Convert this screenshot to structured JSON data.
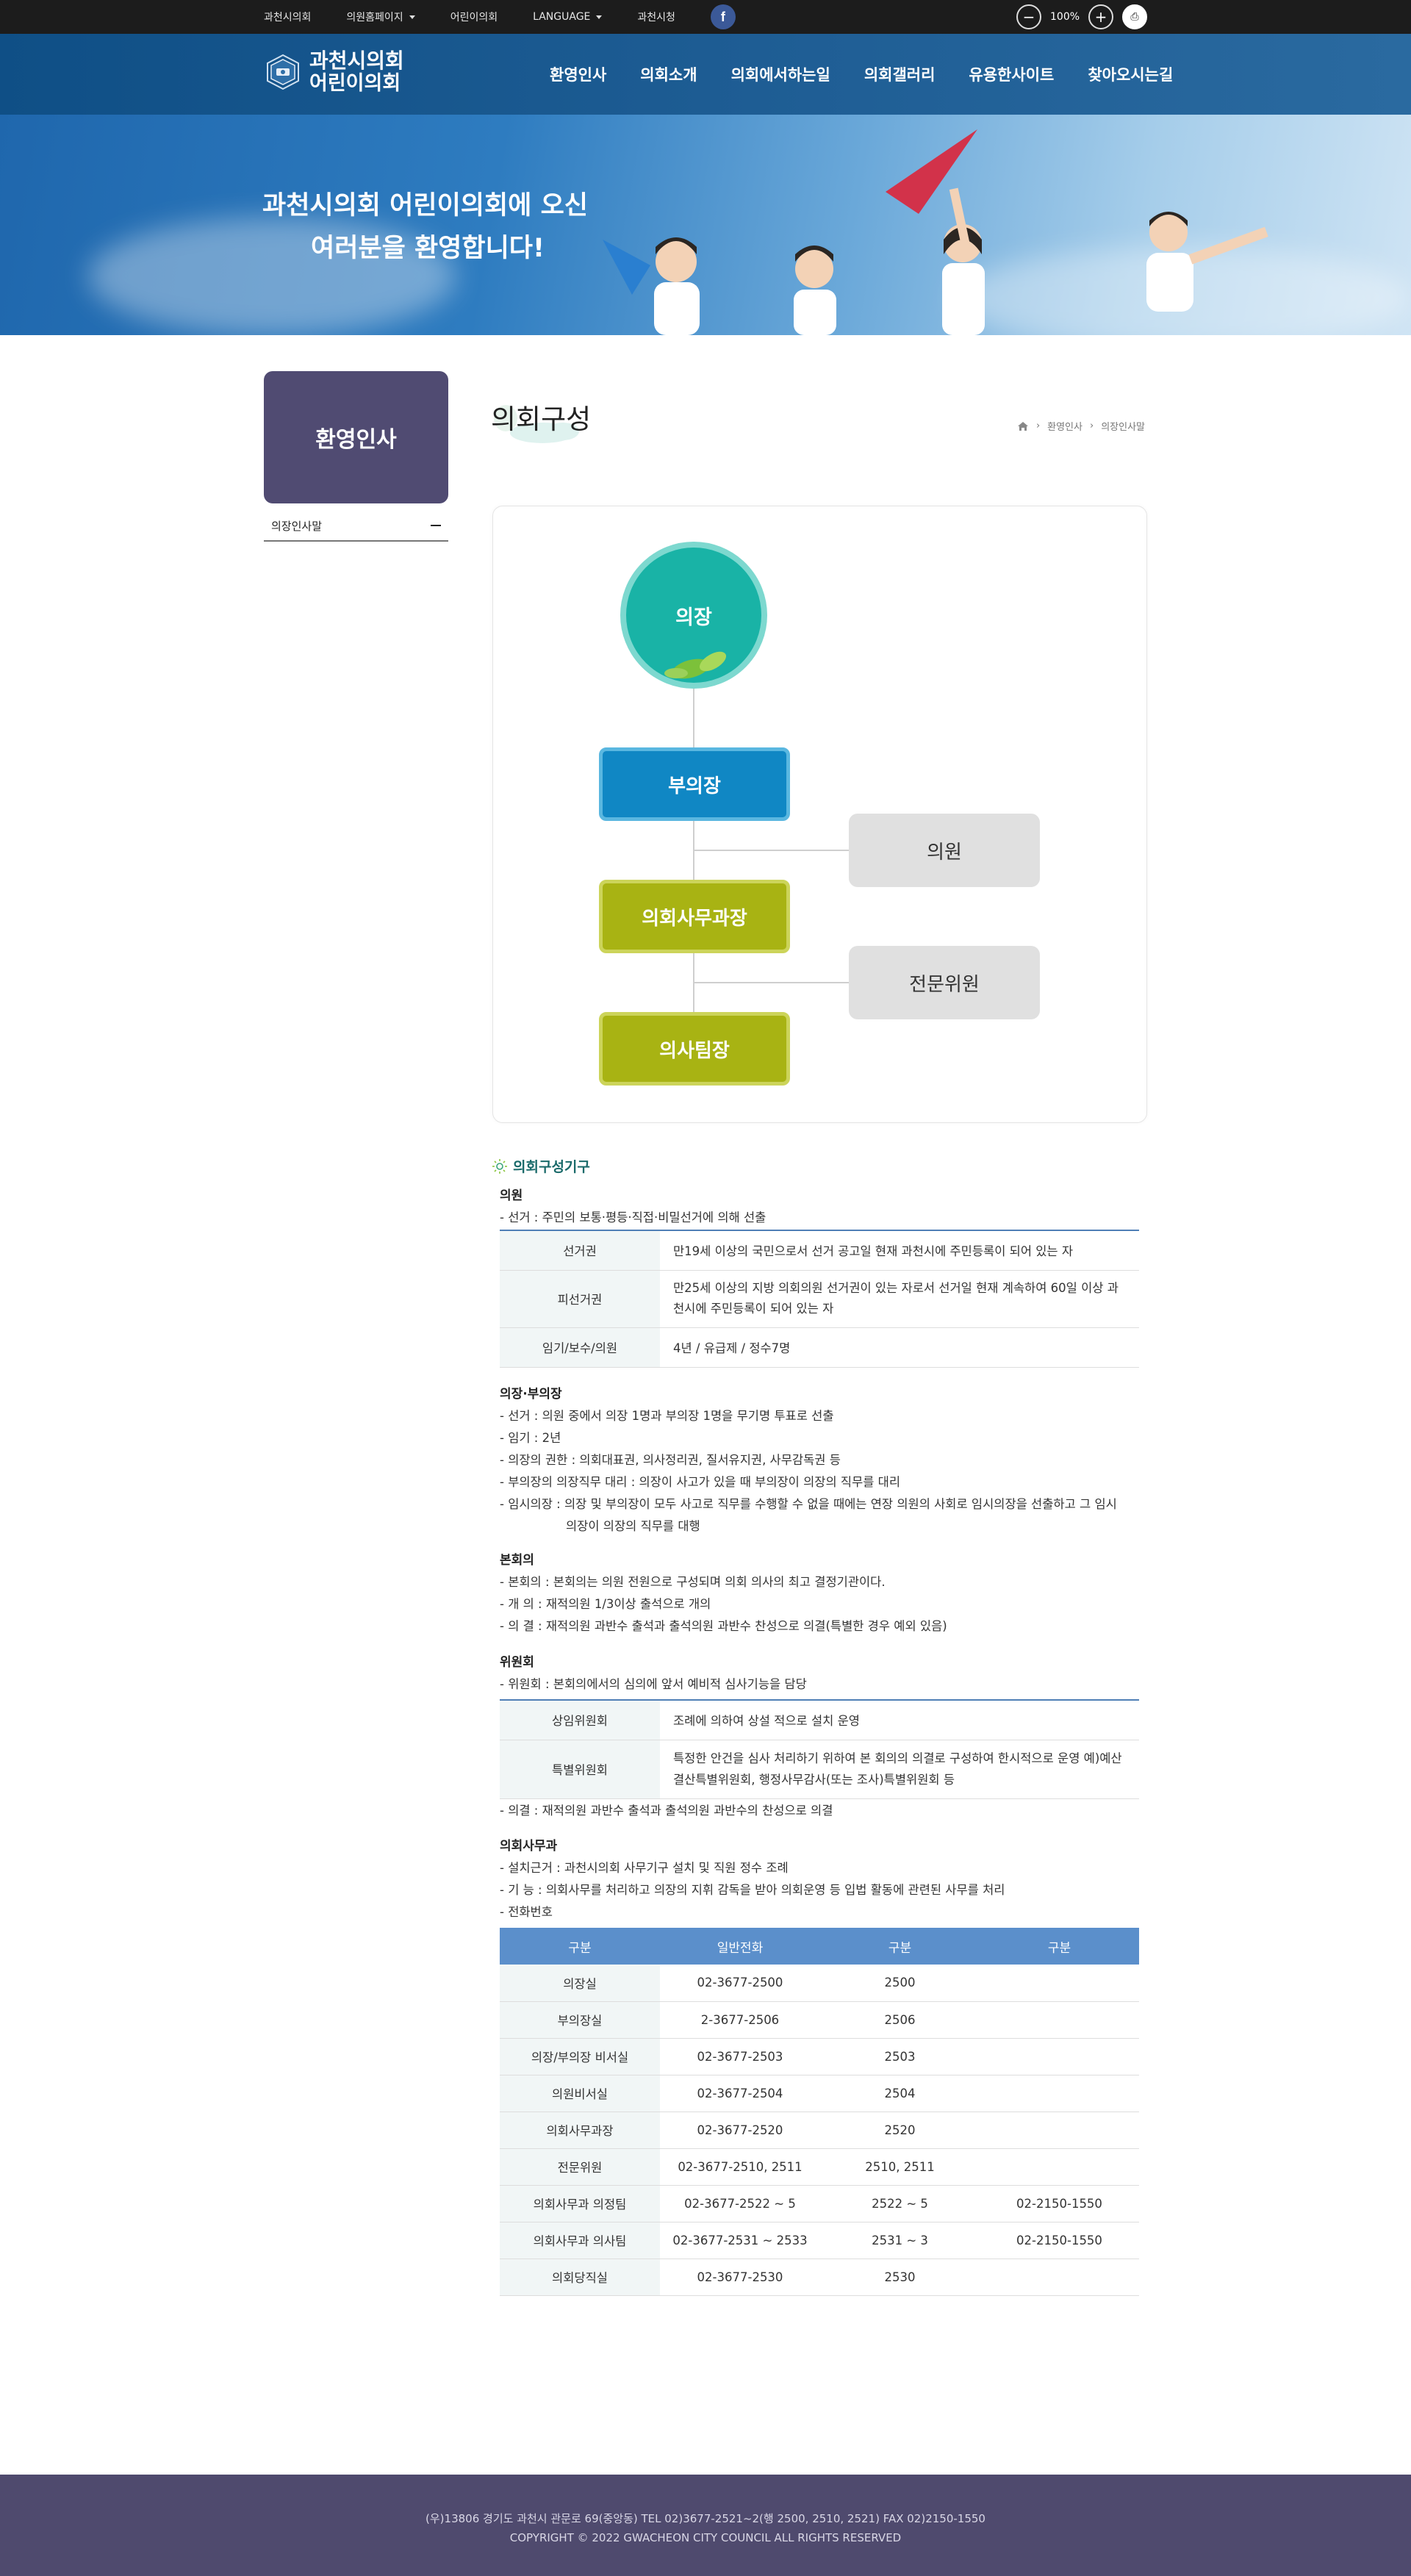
{
  "topbar": {
    "links": [
      {
        "label": "과천시의회",
        "dropdown": false
      },
      {
        "label": "의원홈페이지",
        "dropdown": true
      },
      {
        "label": "어린이의회",
        "dropdown": false
      },
      {
        "label": "LANGUAGE",
        "dropdown": true
      },
      {
        "label": "과천시청",
        "dropdown": false
      }
    ],
    "facebook": "f",
    "zoom_out": "−",
    "zoom_level": "100%",
    "zoom_in": "+",
    "print": "⎙"
  },
  "header": {
    "logo_line1": "과천시의회",
    "logo_line2": "어린이의회",
    "nav": [
      "환영인사",
      "의회소개",
      "의회에서하는일",
      "의회갤러리",
      "유용한사이트",
      "찾아오시는길"
    ]
  },
  "hero": {
    "line1": "과천시의회 어린이의회에 오신",
    "line2": "여러분을 환영합니다!"
  },
  "sidebar": {
    "title": "환영인사",
    "items": [
      {
        "label": "의장인사말"
      }
    ]
  },
  "page": {
    "title": "의회구성",
    "breadcrumb": [
      "환영인사",
      "의장인사말"
    ]
  },
  "org": {
    "chair": "의장",
    "vice": "부의장",
    "member": "의원",
    "secretariat": "의회사무과장",
    "expert": "전문위원",
    "agenda": "의사팀장"
  },
  "section_title": "의회구성기구",
  "council": {
    "heading": "의원",
    "line": "- 선거 : 주민의 보통·평등·직접·비밀선거에 의해 선출",
    "table": [
      {
        "k": "선거권",
        "v": "만19세 이상의 국민으로서 선거 공고일 현재 과천시에 주민등록이 되어 있는 자"
      },
      {
        "k": "피선거권",
        "v": "만25세 이상의 지방 의회의원 선거권이 있는 자로서 선거일 현재 계속하여 60일 이상 과천시에 주민등록이 되어 있는 자"
      },
      {
        "k": "임기/보수/의원",
        "v": "4년 / 유급제 / 정수7명"
      }
    ]
  },
  "chair_section": {
    "heading": "의장·부의장",
    "lines": [
      "- 선거 : 의원 중에서 의장 1명과 부의장 1명을 무기명 투표로 선출",
      "- 임기 : 2년",
      "- 의장의 권한 : 의회대표권, 의사정리권, 질서유지권, 사무감독권 등",
      "- 부의장의 의장직무 대리 : 의장이 사고가 있을 때 부의장이 의장의 직무를 대리",
      "- 임시의장 : 의장 및 부의장이 모두 사고로 직무를 수행할 수 없을 때에는 연장 의원의 사회로 임시의장을 선출하고 그 임시"
    ],
    "line_cont": "의장이 의장의 직무를 대행"
  },
  "plenary": {
    "heading": "본회의",
    "lines": [
      "- 본회의 : 본회의는 의원 전원으로 구성되며 의회 의사의 최고 결정기관이다.",
      "- 개 의 : 재적의원 1/3이상 출석으로 개의",
      "- 의 결 : 재적의원 과반수 출석과 출석의원 과반수 찬성으로 의결(특별한 경우 예외 있음)"
    ]
  },
  "committee": {
    "heading": "위원회",
    "line": "- 위원회 : 본회의에서의 심의에 앞서 예비적 심사기능을 담당",
    "table": [
      {
        "k": "상임위원회",
        "v": "조례에 의하여 상설 적으로 설치 운영"
      },
      {
        "k": "특별위원회",
        "v": "특정한 안건을 심사 처리하기 위하여 본 회의의 의결로 구성하여 한시적으로 운영 예)예산결산특별위원회, 행정사무감사(또는 조사)특별위원회 등"
      }
    ],
    "after": "- 의결 : 재적의원 과반수 출석과 출석의원 과반수의 찬성으로 의결"
  },
  "office": {
    "heading": "의회사무과",
    "lines": [
      "- 설치근거 : 과천시의회 사무기구 설치 및 직원 정수 조례",
      "- 기 능 : 의회사무를 처리하고 의장의 지휘 감독을 받아 의회운영 등 입법 활동에 관련된 사무를 처리",
      "- 전화번호"
    ]
  },
  "phone_table": {
    "headers": [
      "구분",
      "일반전화",
      "구분",
      "구분"
    ],
    "rows": [
      [
        "의장실",
        "02-3677-2500",
        "2500",
        ""
      ],
      [
        "부의장실",
        "2-3677-2506",
        "2506",
        ""
      ],
      [
        "의장/부의장 비서실",
        "02-3677-2503",
        "2503",
        ""
      ],
      [
        "의원비서실",
        "02-3677-2504",
        "2504",
        ""
      ],
      [
        "의회사무과장",
        "02-3677-2520",
        "2520",
        ""
      ],
      [
        "전문위원",
        "02-3677-2510, 2511",
        "2510, 2511",
        ""
      ],
      [
        "의회사무과 의정팀",
        "02-3677-2522 ~ 5",
        "2522 ~ 5",
        "02-2150-1550"
      ],
      [
        "의회사무과 의사팀",
        "02-3677-2531 ~ 2533",
        "2531 ~ 3",
        "02-2150-1550"
      ],
      [
        "의회당직실",
        "02-3677-2530",
        "2530",
        ""
      ]
    ]
  },
  "footer": {
    "line1": "(우)13806 경기도 과천시 관문로 69(중앙동) TEL 02)3677-2521~2(행 2500, 2510, 2521) FAX 02)2150-1550",
    "line2": "COPYRIGHT © 2022 GWACHEON CITY COUNCIL ALL RIGHTS RESERVED"
  },
  "colors": {
    "header_blue": "#1d5c93",
    "side_purple": "#504b72",
    "chair_teal": "#19b3a6",
    "vice_blue": "#1087c4",
    "olive": "#a8b313",
    "table_header": "#5b8fcb",
    "footer": "#4f4a6e"
  }
}
